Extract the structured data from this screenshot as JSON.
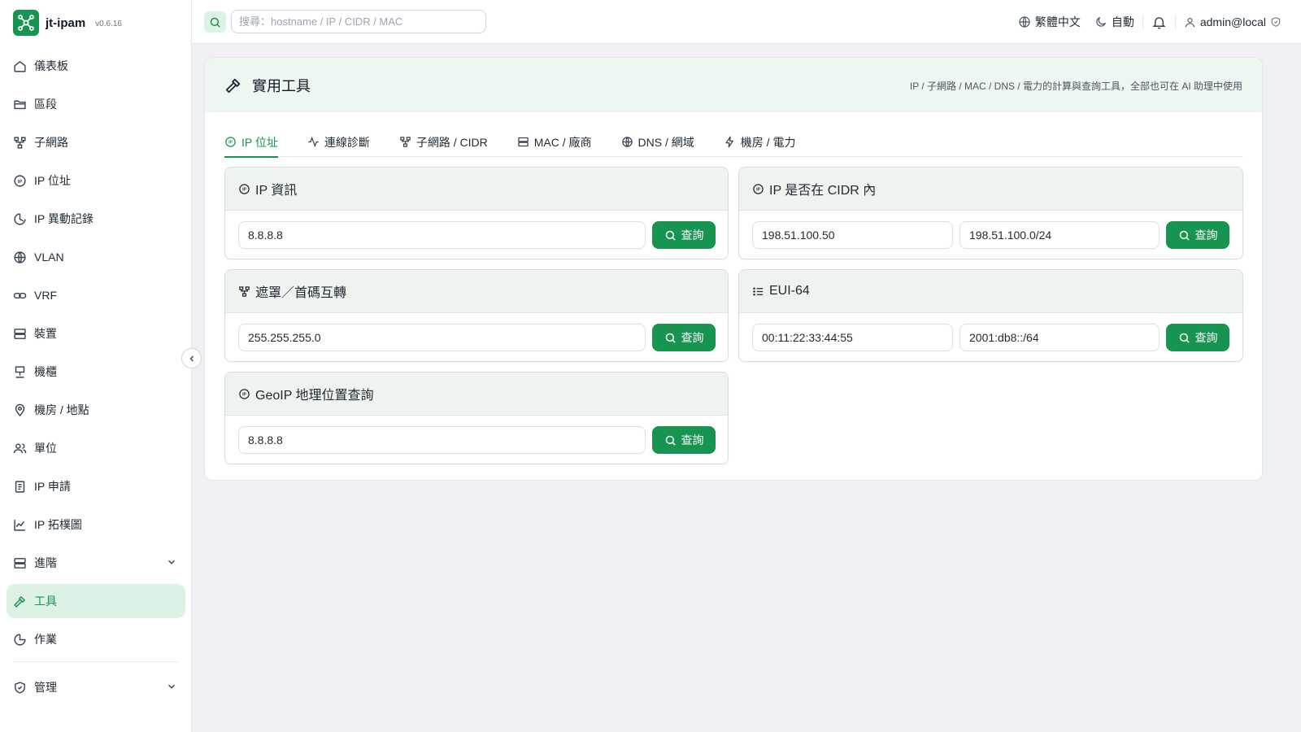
{
  "brand": {
    "name": "jt-ipam",
    "version": "v0.6.16"
  },
  "sidebar": {
    "items": [
      {
        "label": "儀表板"
      },
      {
        "label": "區段"
      },
      {
        "label": "子網路"
      },
      {
        "label": "IP 位址"
      },
      {
        "label": "IP 異動記錄"
      },
      {
        "label": "VLAN"
      },
      {
        "label": "VRF"
      },
      {
        "label": "裝置"
      },
      {
        "label": "機櫃"
      },
      {
        "label": "機房 / 地點"
      },
      {
        "label": "單位"
      },
      {
        "label": "IP 申請"
      },
      {
        "label": "IP 拓樸圖"
      },
      {
        "label": "進階"
      },
      {
        "label": "工具"
      },
      {
        "label": "作業"
      },
      {
        "label": "管理"
      }
    ]
  },
  "topbar": {
    "search_placeholder": "搜尋：hostname / IP / CIDR / MAC",
    "language": "繁體中文",
    "theme": "自動",
    "user": "admin@local"
  },
  "page": {
    "title": "實用工具",
    "subtitle": "IP / 子網路 / MAC / DNS / 電力的計算與查詢工具，全部也可在 AI 助理中使用"
  },
  "tabs": [
    {
      "label": "IP 位址"
    },
    {
      "label": "連線診斷"
    },
    {
      "label": "子網路 / CIDR"
    },
    {
      "label": "MAC / 廠商"
    },
    {
      "label": "DNS / 網域"
    },
    {
      "label": "機房 / 電力"
    }
  ],
  "panels": {
    "ip_info": {
      "title": "IP 資訊",
      "value": "8.8.8.8",
      "button": "查詢"
    },
    "ip_in_cidr": {
      "title": "IP 是否在 CIDR 內",
      "ip": "198.51.100.50",
      "cidr": "198.51.100.0/24",
      "button": "查詢"
    },
    "mask_prefix": {
      "title": "遮罩／首碼互轉",
      "value": "255.255.255.0",
      "button": "查詢"
    },
    "eui64": {
      "title": "EUI-64",
      "mac": "00:11:22:33:44:55",
      "prefix": "2001:db8::/64",
      "button": "查詢"
    },
    "geoip": {
      "title": "GeoIP 地理位置查詢",
      "value": "8.8.8.8",
      "button": "查詢"
    }
  },
  "colors": {
    "accent": "#17944f",
    "accent_light": "#dcf2e5",
    "page_bg": "#eef0f3"
  }
}
